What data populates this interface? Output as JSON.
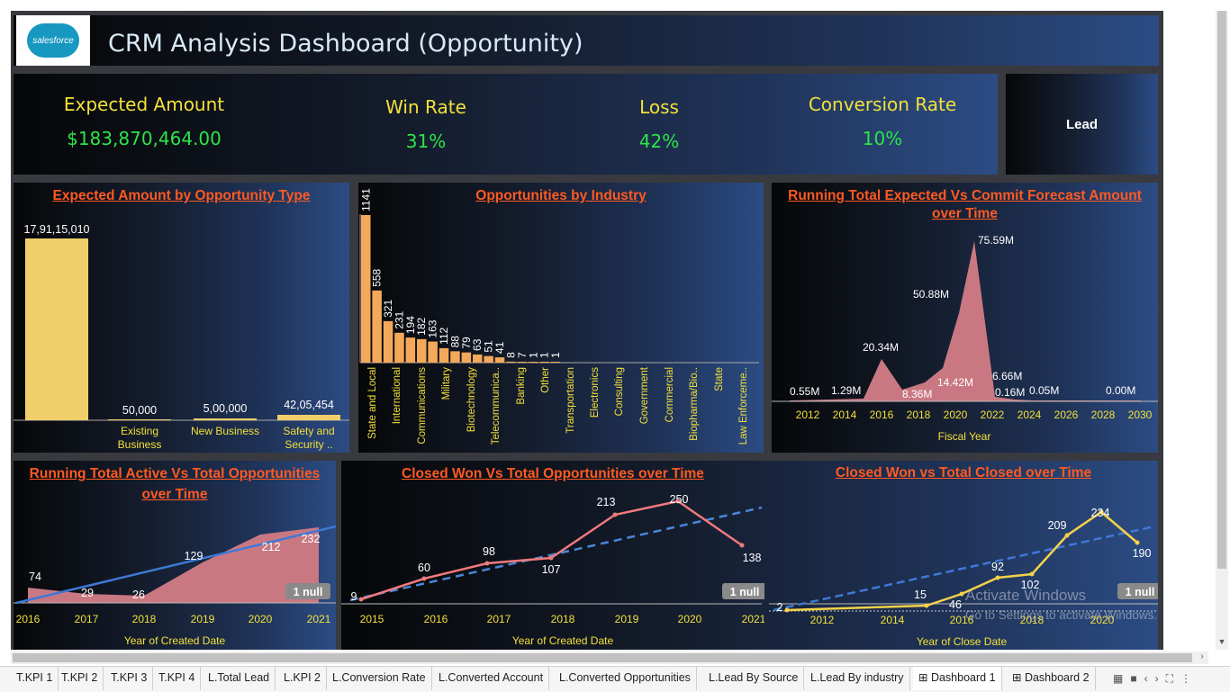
{
  "header": {
    "logo_text": "salesforce",
    "title": "CRM Analysis Dashboard (Opportunity)"
  },
  "kpis": [
    {
      "label": "Expected Amount",
      "value": "$183,870,464.00"
    },
    {
      "label": "Win Rate",
      "value": "31%"
    },
    {
      "label": "Loss",
      "value": "42%"
    },
    {
      "label": "Conversion Rate",
      "value": "10%"
    }
  ],
  "lead_button": "Lead",
  "charts": {
    "opp_type_title": "Expected Amount by Opportunity Type",
    "industry_title": "Opportunities by Industry",
    "forecast_title_1": "Running Total Expected Vs Commit Forecast Amount",
    "forecast_title_2": "over Time",
    "forecast_xlabel": "Fiscal Year",
    "active_title_1": "Running Total Active Vs Total Opportunities",
    "active_title_2": "over Time",
    "active_xlabel": "Year of Created Date",
    "closedwon_title": "Closed Won Vs Total Opportunities over Time",
    "closedwon_xlabel": "Year of Created Date",
    "closedtotal_title": "Closed Won vs Total Closed over Time",
    "closedtotal_xlabel": "Year of Close Date",
    "null_badge": "1 null"
  },
  "colors": {
    "bar_yellow": "#f0cf6a",
    "bar_orange": "#f4a95a",
    "area_red": "#c97882",
    "line_red": "#f07a7e",
    "line_yellow": "#f5d24a",
    "trend_blue": "#3f78d6",
    "title_orange": "#ff5a22",
    "kpi_label": "#f3e03a",
    "kpi_value": "#2de44a"
  },
  "chart_data": [
    {
      "type": "bar",
      "title": "Expected Amount by Opportunity Type",
      "categories": [
        "",
        "Existing Business",
        "New Business",
        "Safety and Security .."
      ],
      "values": [
        179115010,
        50000,
        500000,
        4205454
      ],
      "labels": [
        "17,91,15,010",
        "50,000",
        "5,00,000",
        "42,05,454"
      ]
    },
    {
      "type": "bar",
      "title": "Opportunities by Industry",
      "categories": [
        "State and Local",
        "International",
        "Communications",
        "Military",
        "Biotechnology",
        "Telecommunica..",
        "Banking",
        "Other",
        "Transportation",
        "Electronics",
        "Consulting",
        "Government",
        "Commercial",
        "Biopharma/Bio..",
        "State",
        "Law Enforceme.."
      ],
      "values": [
        1141,
        558,
        321,
        231,
        194,
        182,
        163,
        112,
        88,
        79,
        63,
        51,
        41,
        8,
        7,
        1,
        1,
        1
      ]
    },
    {
      "type": "area",
      "title": "Running Total Expected Vs Commit Forecast Amount over Time",
      "xlabel": "Fiscal Year",
      "xticks": [
        "2012",
        "2014",
        "2016",
        "2018",
        "2020",
        "2022",
        "2024",
        "2026",
        "2028",
        "2030"
      ],
      "labels": [
        "0.55M",
        "1.29M",
        "20.34M",
        "8.36M",
        "50.88M",
        "14.42M",
        "75.59M",
        "6.66M",
        "0.16M",
        "0.05M",
        "0.00M"
      ]
    },
    {
      "type": "area",
      "title": "Running Total Active Vs Total Opportunities over Time",
      "xlabel": "Year of Created Date",
      "x": [
        "2016",
        "2017",
        "2018",
        "2019",
        "2020",
        "2021"
      ],
      "values": [
        74,
        29,
        26,
        129,
        212,
        232
      ]
    },
    {
      "type": "line",
      "title": "Closed Won Vs Total Opportunities over Time",
      "xlabel": "Year of Created Date",
      "x": [
        "2015",
        "2016",
        "2017",
        "2018",
        "2019",
        "2020",
        "2021"
      ],
      "values": [
        9,
        60,
        98,
        107,
        213,
        250,
        138
      ]
    },
    {
      "type": "line",
      "title": "Closed Won vs Total Closed over Time",
      "xlabel": "Year of Close Date",
      "xticks": [
        "2012",
        "2014",
        "2016",
        "2018",
        "2020"
      ],
      "values": [
        2,
        15,
        46,
        92,
        102,
        209,
        234,
        190
      ]
    }
  ],
  "watermark": {
    "line1": "Activate Windows",
    "line2": "Go to Settings to activate Windows."
  },
  "tabs": [
    "T.KPI 1",
    "T.KPI 2",
    "T.KPI 3",
    "T.KPI 4",
    "L.Total Lead",
    "L.KPI 2",
    "L.Conversion Rate",
    "L.Converted Account",
    "L.Converted Opportunities",
    "L.Lead By Source",
    "L.Lead By industry",
    "Dashboard 1",
    "Dashboard 2"
  ],
  "active_tab": "Dashboard 1"
}
